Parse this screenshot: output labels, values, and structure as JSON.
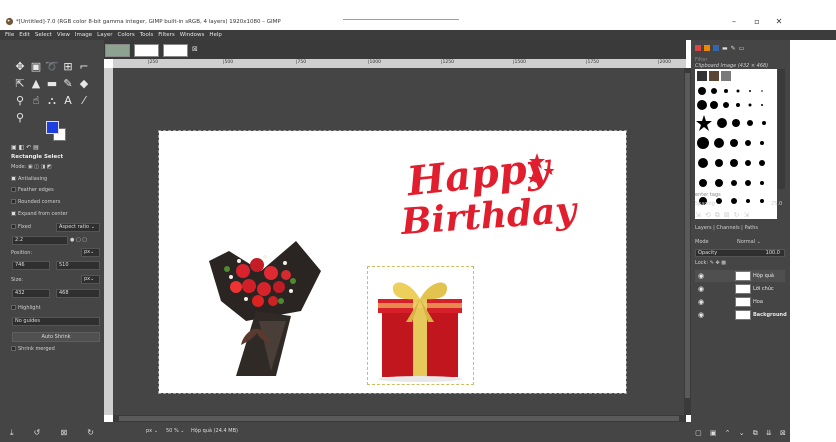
{
  "window": {
    "title": "*[Untitled]-7.0 (RGB color 8-bit gamma integer, GIMP built-in sRGB, 4 layers) 1920x1080 – GIMP",
    "controls": [
      "–",
      "▫",
      "✕"
    ]
  },
  "menu": [
    "File",
    "Edit",
    "Select",
    "View",
    "Image",
    "Layer",
    "Colors",
    "Tools",
    "Filters",
    "Windows",
    "Help"
  ],
  "toolbox": {
    "tool_options_title": "Rectangle Select",
    "mode_label": "Mode:",
    "antialiasing": "Antialiasing",
    "feather_edges": "Feather edges",
    "rounded_corners": "Rounded corners",
    "expand_from_center": "Expand from center",
    "fixed_label": "Fixed",
    "aspect_ratio": "Aspect ratio",
    "ratio_value": "2:2",
    "position_label": "Position:",
    "position_unit": "px",
    "pos_x": "746",
    "pos_y": "510",
    "size_label": "Size:",
    "size_unit": "px",
    "size_w": "432",
    "size_h": "468",
    "highlight": "Highlight",
    "guides": "No guides",
    "auto_shrink": "Auto Shrink",
    "shrink_merged": "Shrink merged",
    "fg_color": "#1e3ede",
    "bg_color": "#ffffff"
  },
  "ruler": {
    "marks": [
      "|250",
      "|500",
      "|750",
      "|1000",
      "|1250",
      "|1500",
      "|1750",
      "|2000"
    ]
  },
  "canvas": {
    "greeting_line1": "Happy",
    "greeting_line2": "Birthday",
    "greeting_color": "#e01e2d"
  },
  "statusbar": {
    "unit": "px",
    "zoom": "50 %",
    "layer_info": "Hộp quà (24.4 MB)"
  },
  "dock": {
    "filter_placeholder": "Filter",
    "brush_name": "Clipboard Image (432 × 468)",
    "tag_placeholder": "enter tags",
    "spacing_label": "Spacing",
    "spacing_value": "25.0",
    "tabs": [
      "Layers",
      "Channels",
      "Paths"
    ],
    "mode_label": "Mode",
    "mode_value": "Normal",
    "opacity_label": "Opacity",
    "opacity_value": "100.0",
    "lock_label": "Lock:",
    "layers": [
      {
        "name": "Hộp quà",
        "selected": true
      },
      {
        "name": "Lời chúc",
        "selected": false
      },
      {
        "name": "Hoa",
        "selected": false
      },
      {
        "name": "Background",
        "selected": false
      }
    ]
  }
}
